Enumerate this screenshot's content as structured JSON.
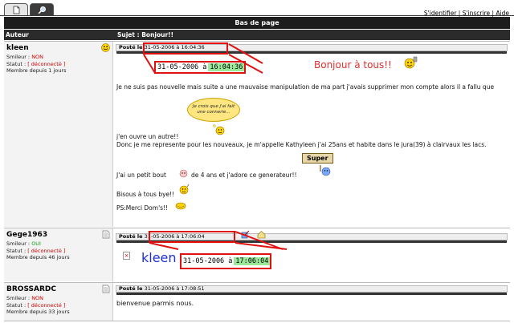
{
  "tabs": [
    {
      "icon": "document-icon",
      "active": false
    },
    {
      "icon": "magnifier-icon",
      "active": true
    }
  ],
  "top_links": {
    "login": "S'identifier",
    "sep1": " | ",
    "register": "S'inscrire",
    "sep2": " | ",
    "help": "Aide"
  },
  "page_title": "Bas de page",
  "columns": {
    "author": "Auteur",
    "subject": "Sujet : Bonjour!!"
  },
  "posts": [
    {
      "author": "kleen",
      "smileur_label": "Smileur : ",
      "smileur_value": "NON",
      "statut_label": "Statut     : ",
      "statut_value": "[ déconnecté ]",
      "member_since": "Membre depuis 1 jours",
      "posted_label": "Posté le",
      "posted_date": "31-05-2006 à 16:04:36",
      "big_date": "31-05-2006 à ",
      "big_time": "16:04:36",
      "greeting": "Bonjour à tous!!",
      "lines": [
        "Je ne suis pas nouvelle mais suite a une mauvaise manipulation de ma part j'avais supprimer mon compte alors il a fallu que",
        "j'en ouvre un autre!!",
        "Donc je me represente pour les nouveaux, je m'appelle Kathyleen j'ai 25ans et habite dans le jura(39) à clairvaux les lacs.",
        "J'ai un petit bout",
        "de 4 ans et j'adore ce generateur!!",
        "Bisous à tous bye!!",
        "PS:Merci Dom's!!"
      ],
      "thought_cloud": "Je crois que j'ai fait une connerie...",
      "sign": "Super"
    },
    {
      "author": "Gege1963",
      "smileur_label": "Smileur : ",
      "smileur_value": "OUI",
      "statut_label": "Statut     : ",
      "statut_value": "[ déconnecté ]",
      "member_since": "Membre depuis 46 jours",
      "posted_label": "Posté le",
      "posted_date": "31-05-2006 à 17:06:04",
      "big_name": "kleen",
      "big_date": "31-05-2006 à ",
      "big_time": "17:06:04",
      "broken_image": "×"
    },
    {
      "author": "BROSSARDC",
      "smileur_label": "Smileur : ",
      "smileur_value": "NON",
      "statut_label": "Statut     : ",
      "statut_value": "[ déconnecté ]",
      "member_since": "Membre depuis 33 jours",
      "posted_label": "Posté le",
      "posted_date": "31-05-2006 à 17:08:51",
      "message": "bienvenue parmis nous."
    }
  ],
  "colors": {
    "highlight_red": "#e01010",
    "time_green": "#9be89b",
    "offline_red": "#cc0000",
    "online_green": "#1a9a1a",
    "title_bar": "#1d1d1d"
  }
}
